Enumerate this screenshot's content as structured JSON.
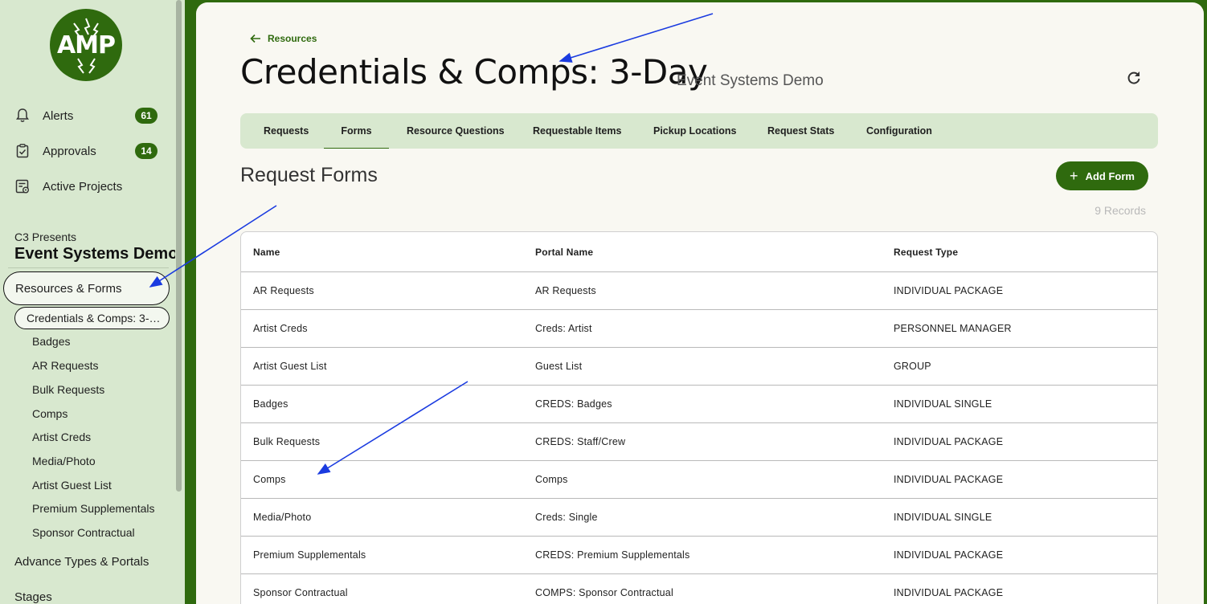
{
  "app": {
    "logo_text": "AMP"
  },
  "sidebar": {
    "nav": [
      {
        "label": "Alerts",
        "badge": "61",
        "icon": "bell-icon"
      },
      {
        "label": "Approvals",
        "badge": "14",
        "icon": "clipboard-check-icon"
      },
      {
        "label": "Active Projects",
        "icon": "projects-icon"
      }
    ],
    "org": "C3 Presents",
    "project": "Event Systems Demo",
    "section": "Resources & Forms",
    "selected_resource": "Credentials & Comps: 3-Day",
    "resources": [
      "Badges",
      "AR Requests",
      "Bulk Requests",
      "Comps",
      "Artist Creds",
      "Media/Photo",
      "Artist Guest List",
      "Premium Supplementals",
      "Sponsor Contractual"
    ],
    "sections": [
      "Advance Types & Portals",
      "Stages"
    ]
  },
  "header": {
    "back_label": "Resources",
    "title": "Credentials & Comps: 3-Day",
    "subtitle": "Event Systems Demo"
  },
  "tabs": [
    "Requests",
    "Forms",
    "Resource Questions",
    "Requestable Items",
    "Pickup Locations",
    "Request Stats",
    "Configuration"
  ],
  "active_tab": "Forms",
  "forms_section": {
    "title": "Request Forms",
    "add_button": "Add Form",
    "records": "9 Records"
  },
  "table": {
    "columns": [
      "Name",
      "Portal Name",
      "Request Type"
    ],
    "rows": [
      [
        "AR Requests",
        "AR Requests",
        "INDIVIDUAL PACKAGE"
      ],
      [
        "Artist Creds",
        "Creds: Artist",
        "PERSONNEL MANAGER"
      ],
      [
        "Artist Guest List",
        "Guest List",
        "GROUP"
      ],
      [
        "Badges",
        "CREDS: Badges",
        "INDIVIDUAL SINGLE"
      ],
      [
        "Bulk Requests",
        "CREDS: Staff/Crew",
        "INDIVIDUAL PACKAGE"
      ],
      [
        "Comps",
        "Comps",
        "INDIVIDUAL PACKAGE"
      ],
      [
        "Media/Photo",
        "Creds: Single",
        "INDIVIDUAL SINGLE"
      ],
      [
        "Premium Supplementals",
        "CREDS: Premium Supplementals",
        "INDIVIDUAL PACKAGE"
      ],
      [
        "Sponsor Contractual",
        "COMPS: Sponsor Contractual",
        "INDIVIDUAL PACKAGE"
      ]
    ]
  },
  "colors": {
    "brand": "#2f6a0e",
    "sidebar_bg": "#d8e8cf",
    "main_bg": "#f9f8f2",
    "annotation": "#1a3be0"
  }
}
